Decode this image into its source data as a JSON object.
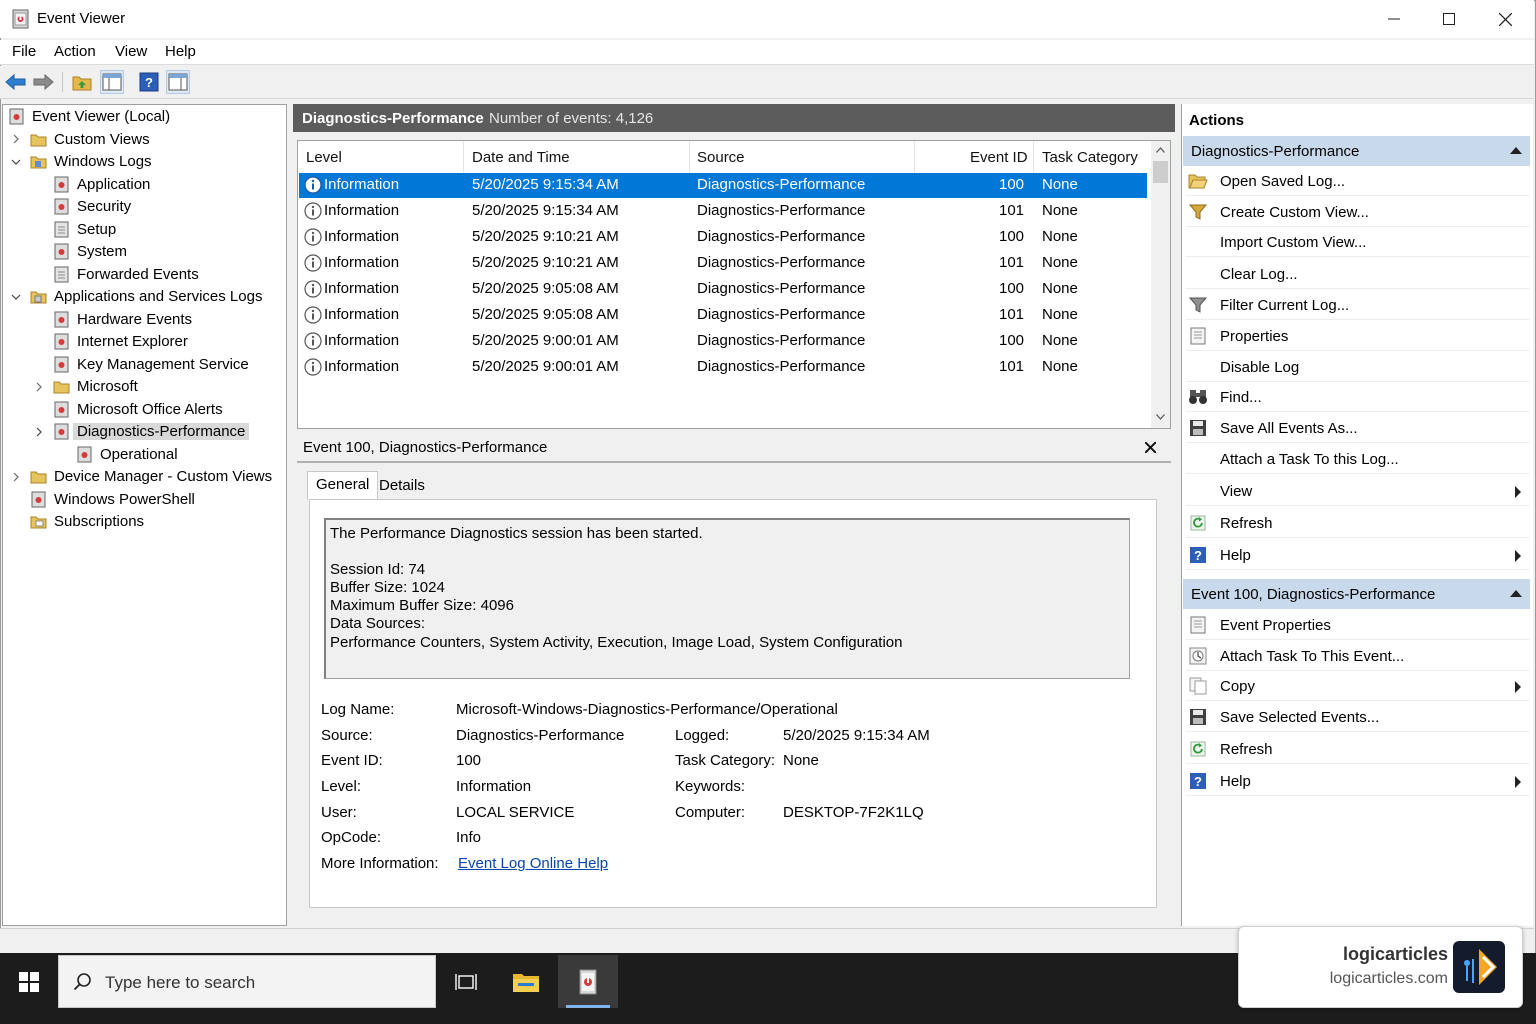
{
  "window": {
    "title": "Event Viewer"
  },
  "menu": [
    "File",
    "Action",
    "View",
    "Help"
  ],
  "tree": {
    "items": [
      {
        "label": "Event Viewer (Local)"
      },
      {
        "label": "Custom Views"
      },
      {
        "label": "Windows Logs"
      },
      {
        "label": "Application"
      },
      {
        "label": "Security"
      },
      {
        "label": "Setup"
      },
      {
        "label": "System"
      },
      {
        "label": "Forwarded Events"
      },
      {
        "label": "Applications and Services Logs"
      },
      {
        "label": "Hardware Events"
      },
      {
        "label": "Internet Explorer"
      },
      {
        "label": "Key Management Service"
      },
      {
        "label": "Microsoft"
      },
      {
        "label": "Microsoft Office Alerts"
      },
      {
        "label": "Diagnostics-Performance"
      },
      {
        "label": "Operational"
      },
      {
        "label": "Device Manager - Custom Views"
      },
      {
        "label": "Windows PowerShell"
      },
      {
        "label": "Subscriptions"
      }
    ],
    "selected": "Diagnostics-Performance"
  },
  "log": {
    "name": "Diagnostics-Performance",
    "count_text": "Number of events: 4,126",
    "columns": [
      "Level",
      "Date and Time",
      "Source",
      "Event ID",
      "Task Category"
    ],
    "rows": [
      {
        "level": "Information",
        "datetime": "5/20/2025 9:15:34 AM",
        "source": "Diagnostics-Performance",
        "event_id": "100",
        "task": "None"
      },
      {
        "level": "Information",
        "datetime": "5/20/2025 9:15:34 AM",
        "source": "Diagnostics-Performance",
        "event_id": "101",
        "task": "None"
      },
      {
        "level": "Information",
        "datetime": "5/20/2025 9:10:21 AM",
        "source": "Diagnostics-Performance",
        "event_id": "100",
        "task": "None"
      },
      {
        "level": "Information",
        "datetime": "5/20/2025 9:10:21 AM",
        "source": "Diagnostics-Performance",
        "event_id": "101",
        "task": "None"
      },
      {
        "level": "Information",
        "datetime": "5/20/2025 9:05:08 AM",
        "source": "Diagnostics-Performance",
        "event_id": "100",
        "task": "None"
      },
      {
        "level": "Information",
        "datetime": "5/20/2025 9:05:08 AM",
        "source": "Diagnostics-Performance",
        "event_id": "101",
        "task": "None"
      },
      {
        "level": "Information",
        "datetime": "5/20/2025 9:00:01 AM",
        "source": "Diagnostics-Performance",
        "event_id": "100",
        "task": "None"
      },
      {
        "level": "Information",
        "datetime": "5/20/2025 9:00:01 AM",
        "source": "Diagnostics-Performance",
        "event_id": "101",
        "task": "None"
      }
    ]
  },
  "detail": {
    "title": "Event 100, Diagnostics-Performance",
    "tabs": [
      "General",
      "Details"
    ],
    "message": [
      "The Performance Diagnostics session has been started.",
      "",
      "Session Id: 74",
      "Buffer Size: 1024",
      "Maximum Buffer Size: 4096",
      "Data Sources:",
      "Performance Counters, System Activity, Execution, Image Load, System Configuration"
    ],
    "labels": {
      "log_name": "Log Name:",
      "source": "Source:",
      "event_id": "Event ID:",
      "level": "Level:",
      "user": "User:",
      "opcode": "OpCode:",
      "more_info": "More Information:",
      "logged": "Logged:",
      "task_category": "Task Category:",
      "keywords": "Keywords:",
      "computer": "Computer:"
    },
    "values": {
      "log_name": "Microsoft-Windows-Diagnostics-Performance/Operational",
      "source": "Diagnostics-Performance",
      "event_id": "100",
      "level": "Information",
      "user": "LOCAL SERVICE",
      "opcode": "Info",
      "more_info_link": "Event Log Online Help",
      "logged": "5/20/2025 9:15:34 AM",
      "task_category": "None",
      "keywords": "",
      "computer": "DESKTOP-7F2K1LQ"
    }
  },
  "actions": {
    "title": "Actions",
    "section1": {
      "title": "Diagnostics-Performance",
      "items": [
        "Open Saved Log...",
        "Create Custom View...",
        "Import Custom View...",
        "Clear Log...",
        "Filter Current Log...",
        "Properties",
        "Disable Log",
        "Find...",
        "Save All Events As...",
        "Attach a Task To this Log...",
        "View",
        "Refresh",
        "Help"
      ]
    },
    "section2": {
      "title": "Event 100, Diagnostics-Performance",
      "items": [
        "Event Properties",
        "Attach Task To This Event...",
        "Copy",
        "Save Selected Events...",
        "Refresh",
        "Help"
      ]
    }
  },
  "taskbar": {
    "search_placeholder": "Type here to search"
  },
  "brand": {
    "name": "logicarticles",
    "url": "logicarticles.com"
  },
  "colors": {
    "selection": "#0078d7",
    "section_header": "#c8d9ec",
    "log_header": "#5c5c5c",
    "link": "#0645ad"
  }
}
